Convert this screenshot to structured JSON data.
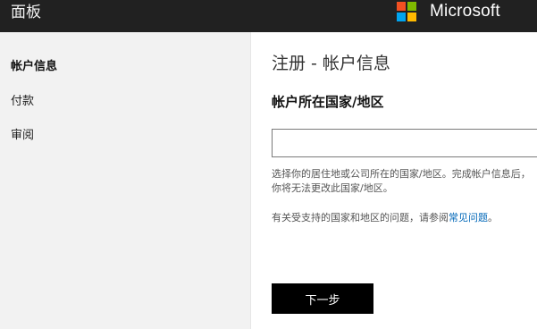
{
  "header": {
    "title": "面板",
    "brand": "Microsoft",
    "logo_colors": [
      "#f25022",
      "#7fba00",
      "#00a4ef",
      "#ffb900"
    ]
  },
  "sidebar": {
    "items": [
      {
        "label": "帐户信息",
        "active": true
      },
      {
        "label": "付款",
        "active": false
      },
      {
        "label": "审阅",
        "active": false
      }
    ]
  },
  "main": {
    "title": "注册 - 帐户信息",
    "section_heading": "帐户所在国家/地区",
    "country_input_value": "",
    "help_text": "选择你的居住地或公司所在的国家/地区。完成帐户信息后，你将无法更改此国家/地区。",
    "faq_prefix": "有关受支持的国家和地区的问题，请参阅",
    "faq_link": "常见问题",
    "faq_suffix": "。",
    "next_button": "下一步"
  },
  "colors": {
    "topbar": "#212121",
    "sidebar_bg": "#f2f2f2",
    "link": "#0067b8",
    "button": "#000000"
  }
}
